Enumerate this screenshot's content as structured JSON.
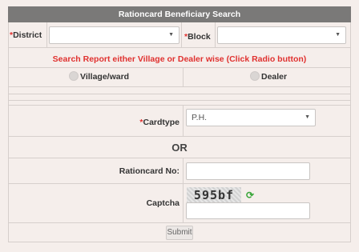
{
  "title": "Rationcard Beneficiary Search",
  "district": {
    "label": "District",
    "value": ""
  },
  "block": {
    "label": "Block",
    "value": ""
  },
  "notice": "Search Report either Village or Dealer wise (Click Radio button)",
  "radio": {
    "village": "Village/ward",
    "dealer": "Dealer"
  },
  "cardtype": {
    "label": "Cardtype",
    "value": "P.H."
  },
  "or_text": "OR",
  "rationcard": {
    "label": "Rationcard No:",
    "value": ""
  },
  "captcha": {
    "label": "Captcha",
    "code": "595bf",
    "refresh_icon": "refresh-icon",
    "value": ""
  },
  "submit_label": "Submit",
  "colors": {
    "header_bg": "#7a7978",
    "required": "#e0312f",
    "page_bg": "#f5eeeb",
    "refresh": "#3aa63a"
  }
}
